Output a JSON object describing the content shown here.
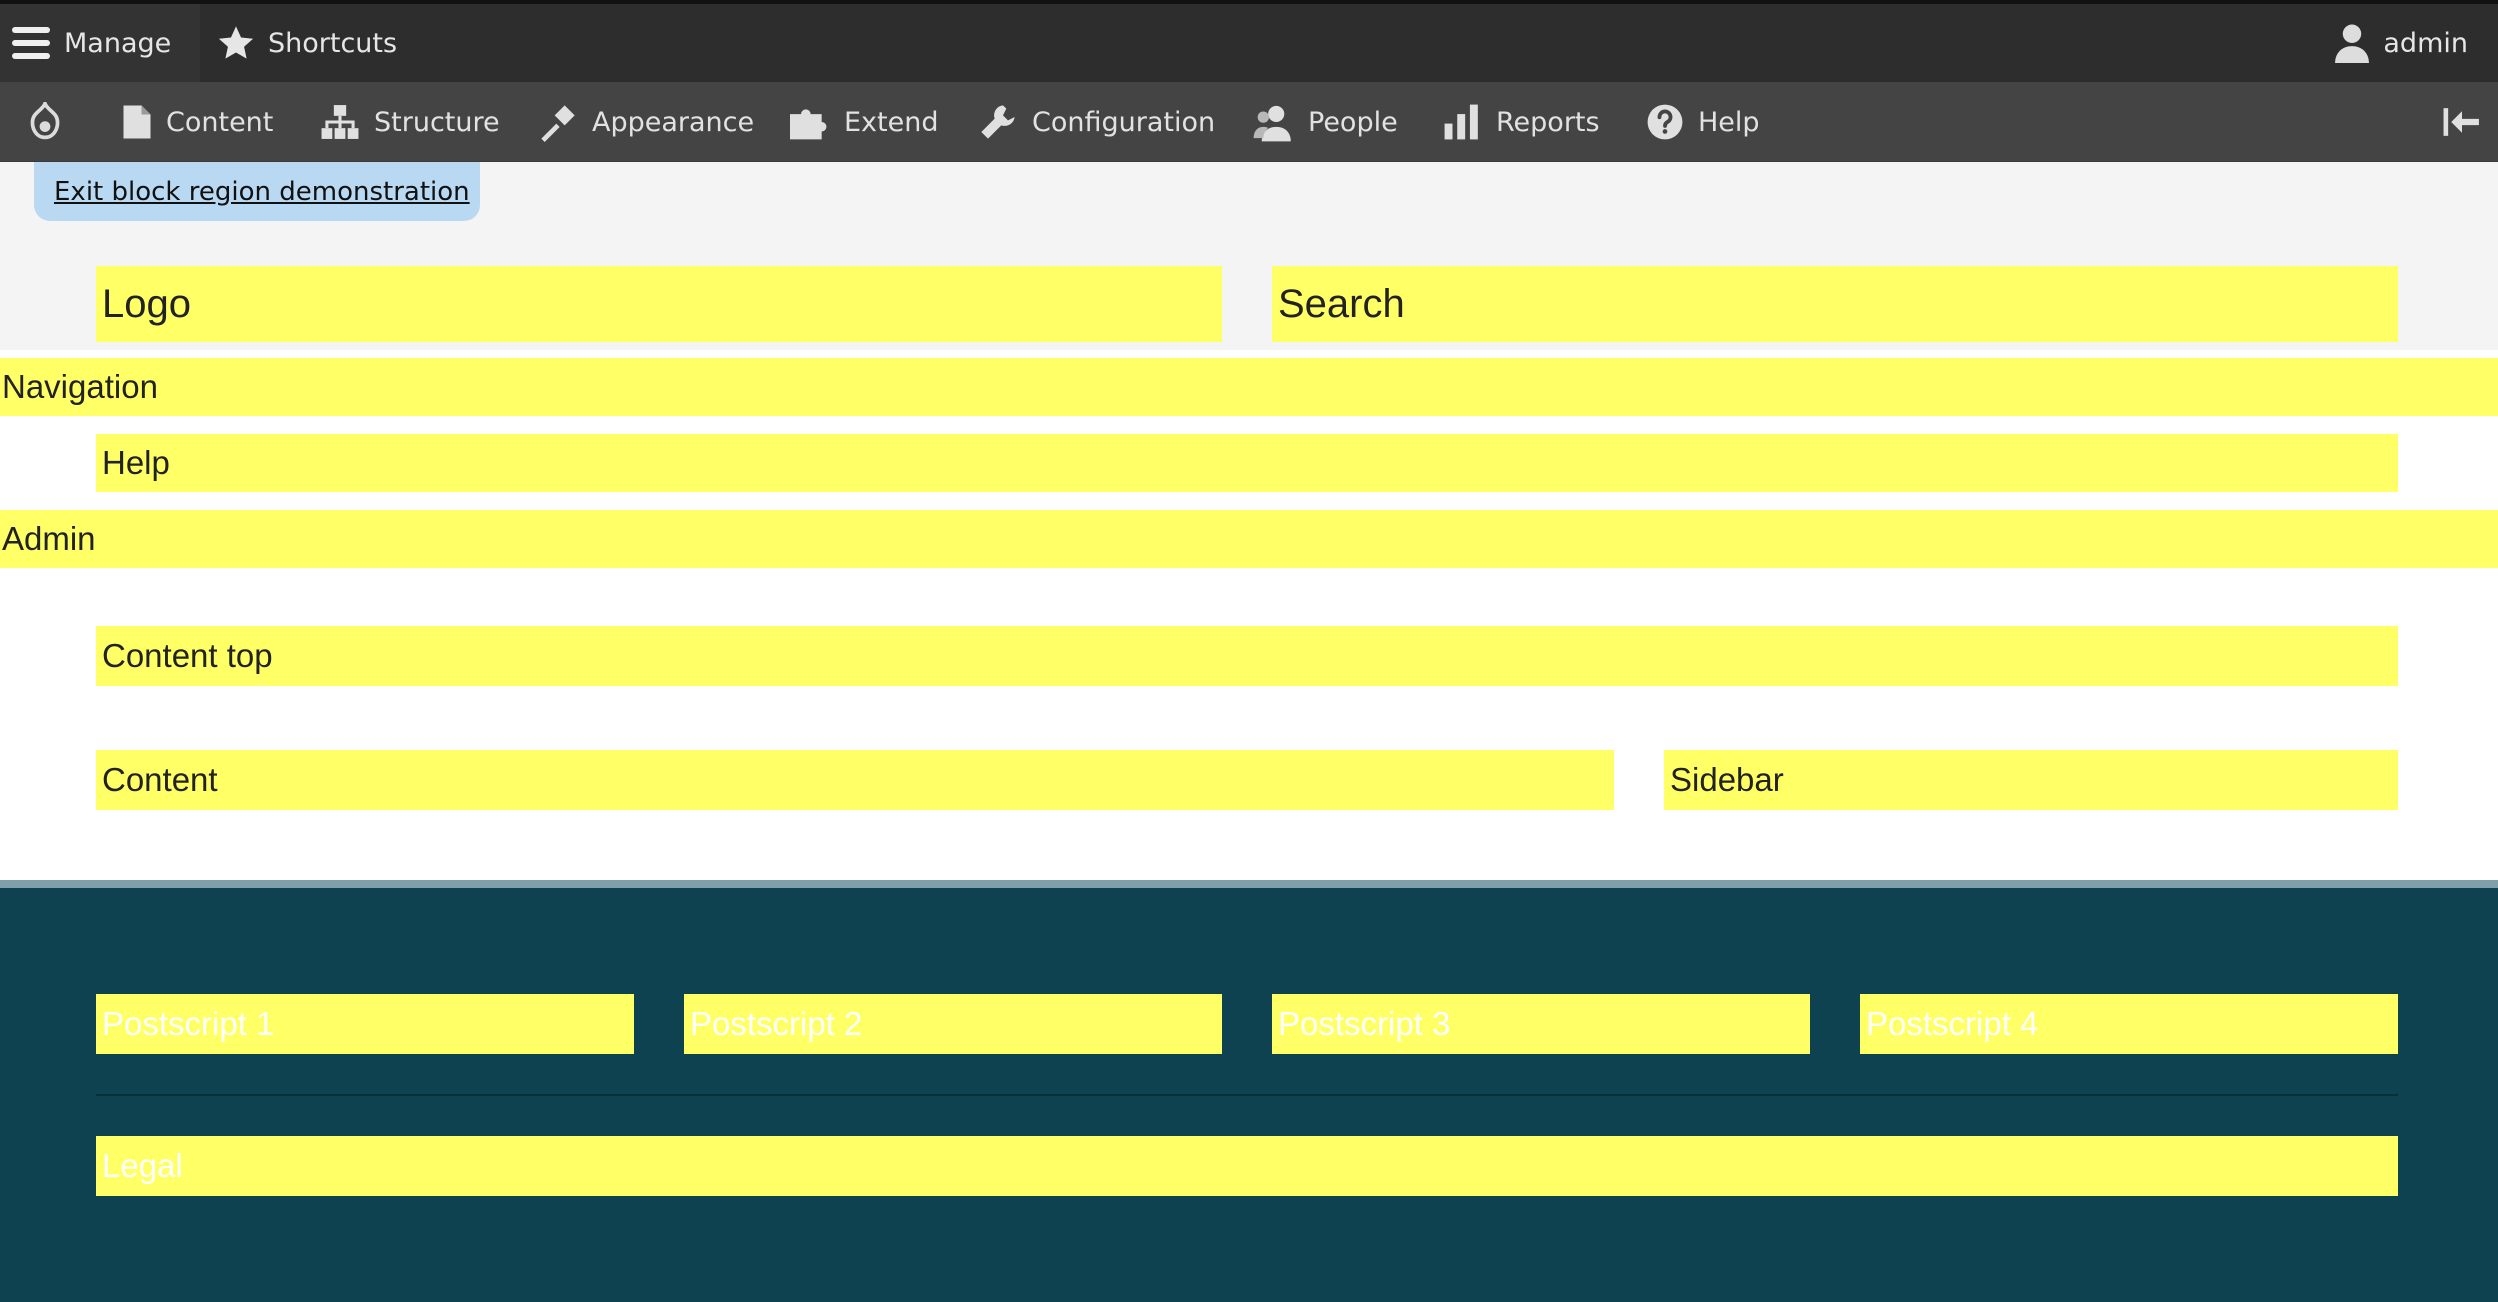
{
  "topbar": {
    "manage_label": "Manage",
    "shortcuts_label": "Shortcuts",
    "user_label": "admin"
  },
  "toolbar": {
    "items": [
      {
        "label": "Content",
        "icon": "document-icon"
      },
      {
        "label": "Structure",
        "icon": "sitemap-icon"
      },
      {
        "label": "Appearance",
        "icon": "paintbrush-icon"
      },
      {
        "label": "Extend",
        "icon": "puzzle-icon"
      },
      {
        "label": "Configuration",
        "icon": "wrench-icon"
      },
      {
        "label": "People",
        "icon": "people-icon"
      },
      {
        "label": "Reports",
        "icon": "bar-chart-icon"
      },
      {
        "label": "Help",
        "icon": "help-icon"
      }
    ]
  },
  "exit_label": "Exit block region demonstration",
  "regions": {
    "logo": "Logo",
    "search": "Search",
    "navigation": "Navigation",
    "help": "Help",
    "admin": "Admin",
    "content_top": "Content top",
    "content": "Content",
    "sidebar": "Sidebar",
    "postscript_1": "Postscript 1",
    "postscript_2": "Postscript 2",
    "postscript_3": "Postscript 3",
    "postscript_4": "Postscript 4",
    "legal": "Legal"
  },
  "colors": {
    "region_highlight": "#ffff66",
    "footer_background": "#0f4250",
    "toolbar_background": "#444444",
    "exit_button_background": "#b9d9f2"
  }
}
